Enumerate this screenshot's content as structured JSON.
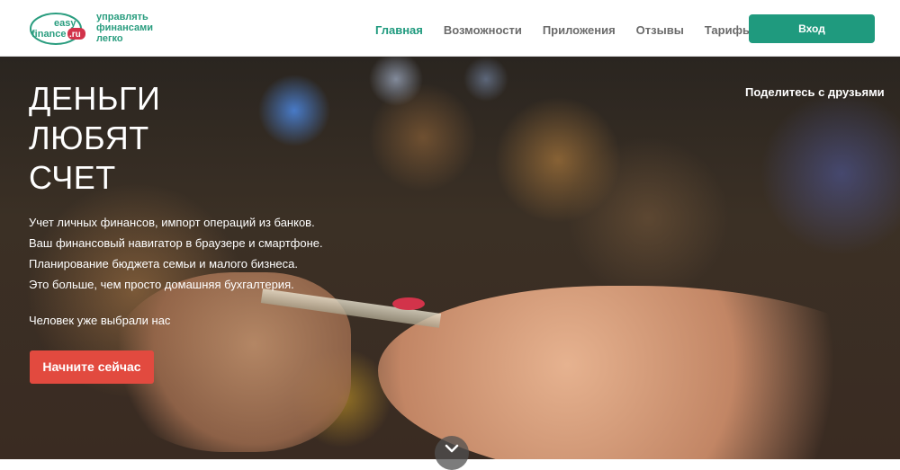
{
  "header": {
    "logo": {
      "line1": "easy",
      "line2": "finance",
      "line3": ".ru"
    },
    "tagline": [
      "управлять",
      "финансами",
      "легко"
    ],
    "nav": [
      {
        "label": "Главная",
        "active": true
      },
      {
        "label": "Возможности"
      },
      {
        "label": "Приложения"
      },
      {
        "label": "Отзывы"
      },
      {
        "label": "Тарифы"
      }
    ],
    "login_label": "Вход"
  },
  "hero": {
    "title": [
      "ДЕНЬГИ",
      "ЛЮБЯТ",
      "СЧЕТ"
    ],
    "share_label": "Поделитесь с друзьями",
    "description": [
      "Учет личных финансов, импорт операций из банков.",
      "Ваш финансовый навигатор в браузере и смартфоне.",
      "Планирование бюджета семьи и малого бизнеса.",
      "Это больше, чем просто домашняя бухгалтерия."
    ],
    "chosen_text": "Человек уже выбрали нас",
    "cta_label": "Начните сейчас",
    "scroll_icon": "chevron-down-icon"
  },
  "colors": {
    "brand_green": "#1f9a7e",
    "cta_red": "#e24a3f",
    "logo_red": "#d2334a"
  }
}
